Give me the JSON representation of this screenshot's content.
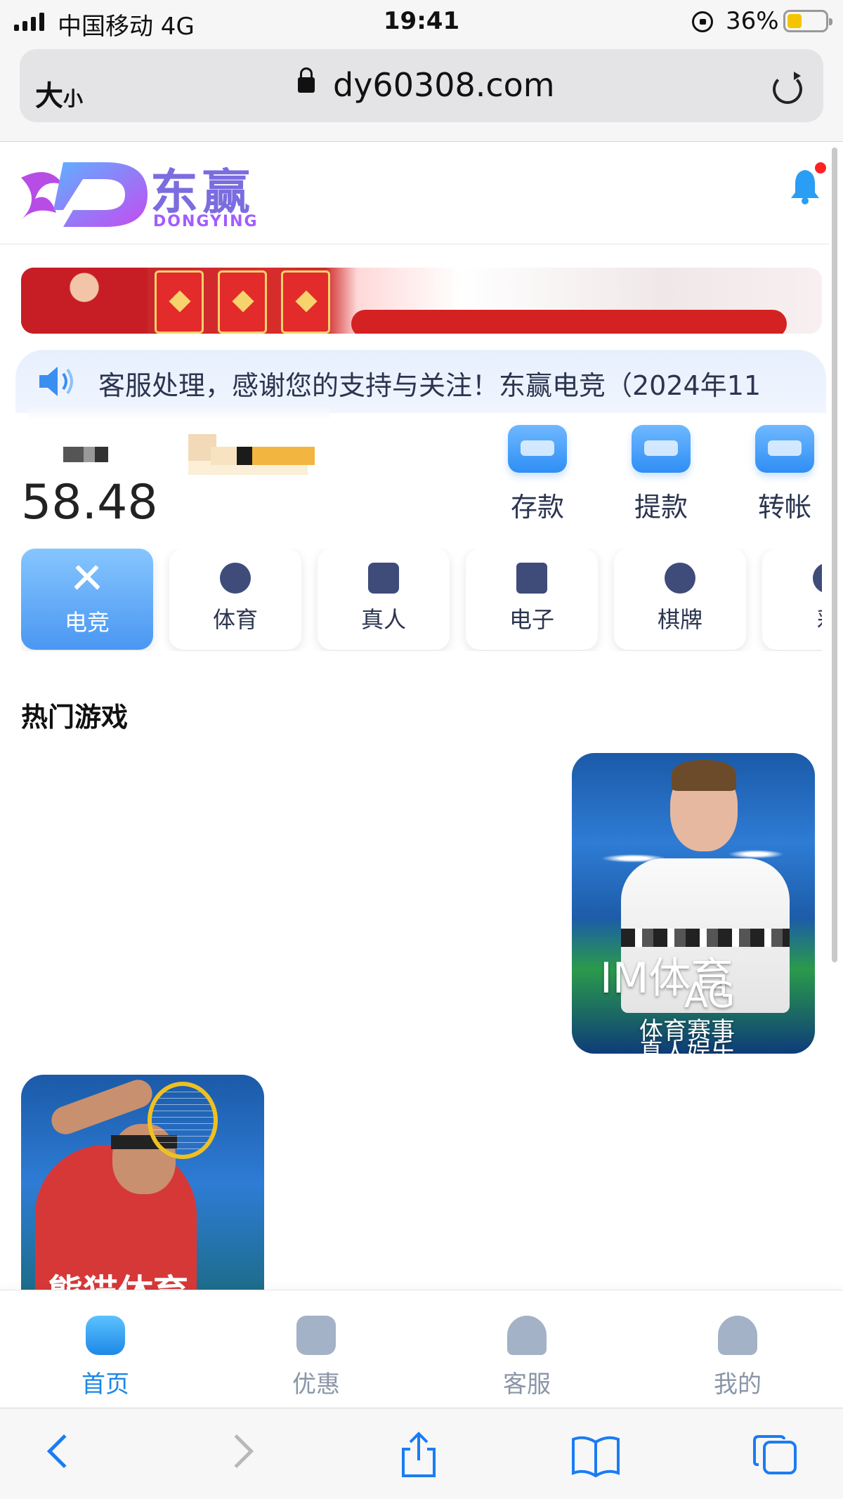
{
  "status_bar": {
    "carrier": "中国移动  4G",
    "time": "19:41",
    "battery": "36%"
  },
  "address_bar": {
    "text_size_label": "大",
    "text_size_small": "小",
    "domain": "dy60308.com"
  },
  "header": {
    "logo_cn": "东赢",
    "logo_en": "DONGYING"
  },
  "notice": {
    "text": "客服处理，感谢您的支持与关注！东赢电竞（2024年11"
  },
  "account": {
    "balance": "58.48"
  },
  "quick_actions": [
    {
      "label": "存款",
      "icon": "deposit-icon"
    },
    {
      "label": "提款",
      "icon": "withdraw-icon"
    },
    {
      "label": "转帐",
      "icon": "transfer-icon"
    }
  ],
  "categories": [
    {
      "label": "电竞",
      "icon": "crossed-swords-icon",
      "active": true
    },
    {
      "label": "体育",
      "icon": "soccer-ball-icon"
    },
    {
      "label": "真人",
      "icon": "dice-icon"
    },
    {
      "label": "电子",
      "icon": "slot-machine-icon"
    },
    {
      "label": "棋牌",
      "icon": "club-suit-icon"
    },
    {
      "label": "彩",
      "icon": "lottery-icon"
    }
  ],
  "hot_games": {
    "title": "热门游戏",
    "cards": [
      {
        "title": "IM体育",
        "overlay": "AG",
        "sub1": "体育赛事",
        "sub2": "真人娱乐"
      },
      {
        "title": "熊猫体育"
      }
    ]
  },
  "tab_bar": [
    {
      "label": "首页",
      "icon": "home-icon",
      "active": true
    },
    {
      "label": "优惠",
      "icon": "gift-icon"
    },
    {
      "label": "客服",
      "icon": "headset-icon"
    },
    {
      "label": "我的",
      "icon": "user-icon"
    }
  ],
  "colors": {
    "accent": "#1e86e6",
    "text_dark": "#2b3550",
    "tab_inactive": "#8a96a8"
  }
}
